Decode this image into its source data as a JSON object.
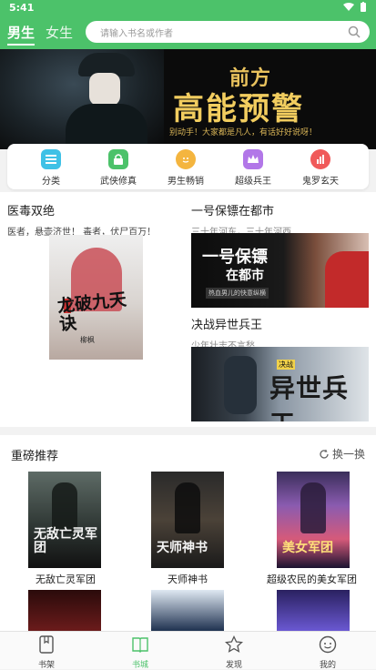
{
  "status": {
    "time": "5:41"
  },
  "header": {
    "tabs": [
      {
        "label": "男生"
      },
      {
        "label": "女生"
      }
    ],
    "search_placeholder": "请输入书名或作者"
  },
  "banner": {
    "title_small": "前方",
    "title_big": "高能预警",
    "subtitle": "别动手！大家都是凡人，有话好好说呀！"
  },
  "categories": [
    {
      "label": "分类",
      "color": "#3fc1e6",
      "icon": "list-icon"
    },
    {
      "label": "武侠修真",
      "color": "#4cc26a",
      "icon": "lock-icon"
    },
    {
      "label": "男生畅销",
      "color": "#f4b53f",
      "icon": "face-icon"
    },
    {
      "label": "超级兵王",
      "color": "#b277e8",
      "icon": "crown-icon"
    },
    {
      "label": "鬼罗玄天",
      "color": "#f05a5a",
      "icon": "chart-icon"
    }
  ],
  "featured": {
    "big": {
      "title": "医毒双绝",
      "desc": "医者，悬壶济世！ 毒者，伏尸百万！",
      "cover_title": "龙破九天诀",
      "cover_author": "柳枫"
    },
    "right": [
      {
        "title": "一号保镖在都市",
        "desc": "三十年河东，三十年河西",
        "cover_line1": "一号保镖",
        "cover_line2": "在都市",
        "cover_line3": "热血男儿的快意纵横"
      },
      {
        "title": "决战异世兵王",
        "desc": "少年壮志不言愁",
        "cover_tag": "决战",
        "cover_title": "异世兵王"
      }
    ]
  },
  "recommend": {
    "title": "重磅推荐",
    "refresh": "换一换",
    "books": [
      {
        "title": "无敌亡灵军团",
        "cover_text": "无敌亡灵军团"
      },
      {
        "title": "天师神书",
        "cover_text": "天师神书"
      },
      {
        "title": "超级农民的美女军团",
        "cover_text": "美女军团"
      }
    ]
  },
  "tabbar": [
    {
      "label": "书架",
      "icon": "bookshelf-icon"
    },
    {
      "label": "书城",
      "icon": "bookstore-icon",
      "active": true
    },
    {
      "label": "发现",
      "icon": "star-icon"
    },
    {
      "label": "我的",
      "icon": "profile-icon"
    }
  ]
}
